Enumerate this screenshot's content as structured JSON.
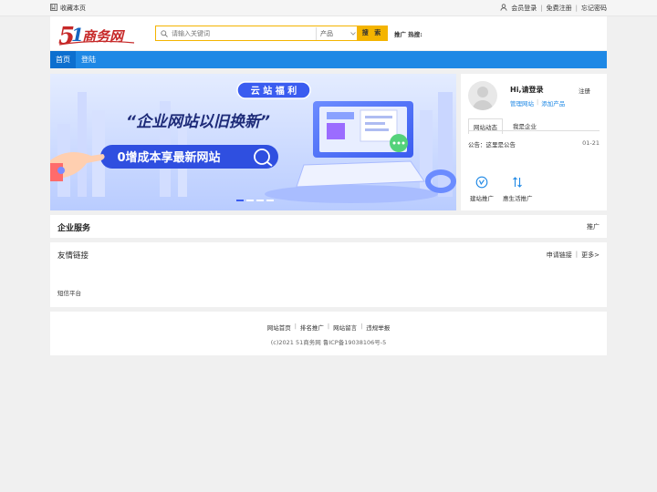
{
  "topbar": {
    "favorite_label": "收藏本页",
    "member_login": "会员登录",
    "free_register": "免费注册",
    "forgot_password": "忘记密码",
    "sep": "|"
  },
  "logo": {
    "text": "51商务网"
  },
  "search": {
    "placeholder": "请输入关键词",
    "category": "产品",
    "button": "搜 索"
  },
  "hot_label": "推广 热搜:",
  "nav": {
    "items": [
      "首页",
      "登陆"
    ]
  },
  "banner": {
    "badge": "云 站 福 利",
    "headline": "“企业网站以旧换新”",
    "subline": "0增成本享最新网站"
  },
  "user": {
    "greeting": "Hi,请登录",
    "register": "注册",
    "manage_site": "管理网站",
    "add_product": "添加产品",
    "tabs": [
      "网站动态",
      "我是企业"
    ],
    "notice_text": "公告：这里是公告",
    "notice_date": "01-21",
    "quick": [
      "建站推广",
      "惠生活推广"
    ]
  },
  "services": {
    "title": "企业服务",
    "more": "推广"
  },
  "links": {
    "title": "友情链接",
    "apply": "申请链接",
    "more": "更多>",
    "items": [
      "短信平台"
    ]
  },
  "footer": {
    "links": [
      "网站首页",
      "排名推广",
      "网站留言",
      "违规举报"
    ],
    "copyright": "(c)2021 51商务网 鲁ICP备19038106号-5"
  },
  "colors": {
    "primary": "#1e88e5",
    "accent": "#f4b400"
  }
}
